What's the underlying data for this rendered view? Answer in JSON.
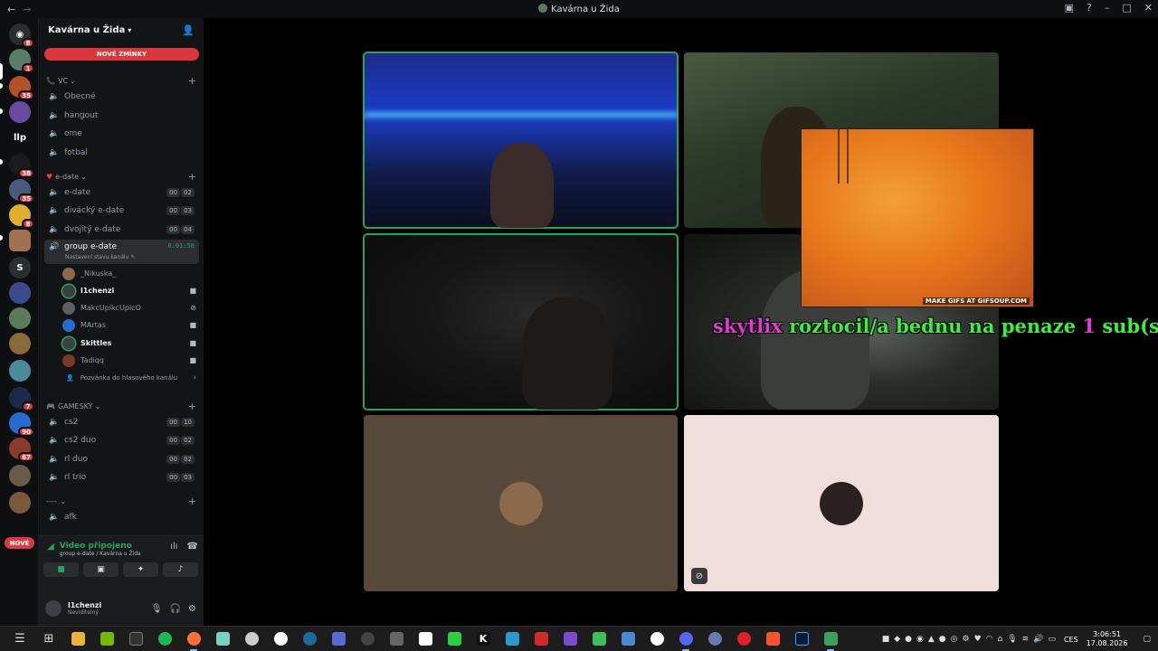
{
  "window": {
    "title": "Kavárna u Žida"
  },
  "guild": {
    "name": "Kavárna u Žida",
    "new_mentions": "NOVÉ ZMÍNKY"
  },
  "rail": {
    "badges": [
      "8",
      "1",
      "35",
      "38",
      "35",
      "8",
      "7",
      "90",
      "67"
    ],
    "llp": "llp",
    "s": "S",
    "nove": "NOVÉ"
  },
  "categories": {
    "vc": "VC",
    "edate": "e-date",
    "gamesky": "GAMESKY",
    "dashes": "----"
  },
  "channels": {
    "obecne": "Obecné",
    "hangout": "hangout",
    "ome": "ome",
    "fotbal": "fotbal",
    "edate": {
      "name": "e-date",
      "a": "00",
      "b": "02"
    },
    "divacky": {
      "name": "divácký e-date",
      "a": "00",
      "b": "03"
    },
    "dvojity": {
      "name": "dvojitý e-date",
      "a": "00",
      "b": "04"
    },
    "group": {
      "name": "group e-date",
      "timer": "6:01:58",
      "sub": "Nastavení stavu kanálu"
    },
    "cs2": {
      "name": "cs2",
      "a": "00",
      "b": "10"
    },
    "cs2duo": {
      "name": "cs2 duo",
      "a": "00",
      "b": "02"
    },
    "rlduo": {
      "name": "rl duo",
      "a": "00",
      "b": "02"
    },
    "rltrio": {
      "name": "rl trio",
      "a": "00",
      "b": "03"
    },
    "afk": "afk"
  },
  "members": [
    {
      "name": "_Nikuska_",
      "color": "#8a6a4a"
    },
    {
      "name": "l1chenzi",
      "color": "#3b3d42"
    },
    {
      "name": "MakcUpikcUpicO",
      "color": "#5b5e63"
    },
    {
      "name": "MArtas",
      "color": "#2a6ad0"
    },
    {
      "name": "Skittles",
      "color": "#3d4046"
    },
    {
      "name": "Tadiqq",
      "color": "#7a3a2a"
    }
  ],
  "invite_label": "Pozvánka do hlasového kanálu",
  "voice": {
    "title": "Video připojeno",
    "sub": "group e-date / Kavárna u Žida"
  },
  "user": {
    "name": "l1chenzi",
    "status": "Neviditelný"
  },
  "overlay": {
    "gif_caption": "MAKE GIFS AT GIFSOUP.COM",
    "alert_user": "skytlix",
    "alert_msg": " roztocil/a bednu na penaze ",
    "alert_num": "1",
    "alert_tail": " sub(s)!"
  },
  "taskbar": {
    "lang": "CES",
    "time": "3:06:51",
    "date": "17.08.2026"
  },
  "colors": {
    "accent_green": "#23a55a",
    "mention_red": "#da373c",
    "alert_magenta": "#e23bd2",
    "alert_green": "#3df03d"
  }
}
